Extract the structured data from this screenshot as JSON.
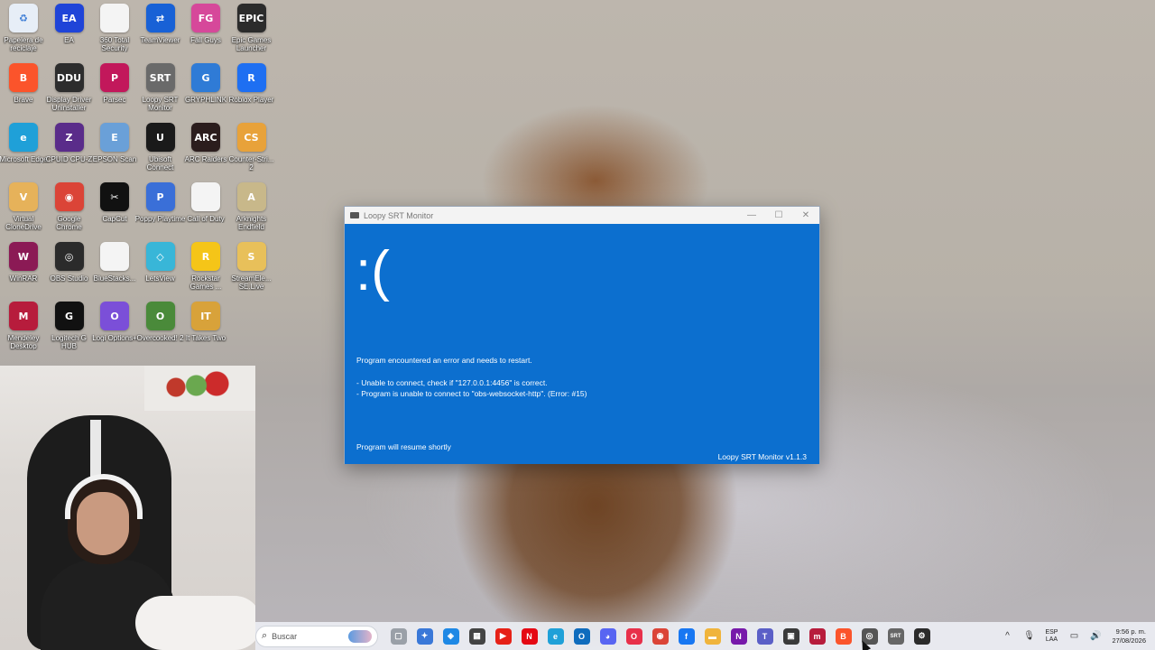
{
  "desktop": {
    "icons": [
      {
        "label": "Papelera de reciclaje",
        "color": "#e7eef7",
        "glyph": "♻"
      },
      {
        "label": "EA",
        "color": "#1f44d8",
        "glyph": "EA"
      },
      {
        "label": "360 Total Security",
        "color": "#f4f4f4",
        "glyph": ""
      },
      {
        "label": "TeamViewer",
        "color": "#1861d6",
        "glyph": "⇄"
      },
      {
        "label": "Fall Guys",
        "color": "#d6489a",
        "glyph": "FG"
      },
      {
        "label": "Epic Games Launcher",
        "color": "#2b2b2b",
        "glyph": "EPIC"
      },
      {
        "label": "Brave",
        "color": "#fb542b",
        "glyph": "B"
      },
      {
        "label": "Display Driver Uninstaller",
        "color": "#2d2d2d",
        "glyph": "DDU"
      },
      {
        "label": "Parsec",
        "color": "#c2185b",
        "glyph": "P"
      },
      {
        "label": "Loopy SRT Monitor",
        "color": "#6a6a6a",
        "glyph": "SRT"
      },
      {
        "label": "GRYPHLINK",
        "color": "#2f7bd6",
        "glyph": "G"
      },
      {
        "label": "Roblox Player",
        "color": "#1e6ff2",
        "glyph": "R"
      },
      {
        "label": "Microsoft Edge",
        "color": "#1fa0d8",
        "glyph": "e"
      },
      {
        "label": "CPUID CPU-Z",
        "color": "#5a2c8a",
        "glyph": "Z"
      },
      {
        "label": "EPSON Scan",
        "color": "#6aa0d8",
        "glyph": "E"
      },
      {
        "label": "Ubisoft Connect",
        "color": "#1a1a1a",
        "glyph": "U"
      },
      {
        "label": "ARC Raiders",
        "color": "#2b1d1d",
        "glyph": "ARC"
      },
      {
        "label": "Counter-Stri... 2",
        "color": "#e8a23a",
        "glyph": "CS"
      },
      {
        "label": "Virtual CloneDrive",
        "color": "#e6b25a",
        "glyph": "V"
      },
      {
        "label": "Google Chrome",
        "color": "#db4437",
        "glyph": "◉"
      },
      {
        "label": "CapCut",
        "color": "#111111",
        "glyph": "✂"
      },
      {
        "label": "Poppy Playtime",
        "color": "#3a6fd8",
        "glyph": "P"
      },
      {
        "label": "Call of Duty",
        "color": "#f4f4f4",
        "glyph": ""
      },
      {
        "label": "Arknights Endfield",
        "color": "#c8b88a",
        "glyph": "A"
      },
      {
        "label": "WinRAR",
        "color": "#8b1a55",
        "glyph": "W"
      },
      {
        "label": "OBS Studio",
        "color": "#2b2b2b",
        "glyph": "◎"
      },
      {
        "label": "BlueStacks...",
        "color": "#f4f4f4",
        "glyph": ""
      },
      {
        "label": "LetsView",
        "color": "#38b6d8",
        "glyph": "◇"
      },
      {
        "label": "Rockstar Games ...",
        "color": "#f5c518",
        "glyph": "R"
      },
      {
        "label": "StreamEle... SE.Live",
        "color": "#e8c05a",
        "glyph": "S"
      },
      {
        "label": "Mendeley Desktop",
        "color": "#b71c3c",
        "glyph": "M"
      },
      {
        "label": "Logitech G HUB",
        "color": "#111111",
        "glyph": "G"
      },
      {
        "label": "Logi Options+",
        "color": "#7b4fd8",
        "glyph": "O"
      },
      {
        "label": "Overcooked! 2",
        "color": "#4a8a3a",
        "glyph": "O"
      },
      {
        "label": "It Takes Two",
        "color": "#d8a23a",
        "glyph": "IT"
      }
    ]
  },
  "srt_window": {
    "title": "Loopy SRT Monitor",
    "minimize": "—",
    "maximize": "☐",
    "close": "✕",
    "face": ":(",
    "message": "Program encountered an error and needs to restart.",
    "detail_1": "- Unable to connect, check if \"127.0.0.1:4456\" is correct.",
    "detail_2": "- Program is unable to connect to \"obs-websocket-http\". (Error: #15)",
    "resume": "Program will resume shortly",
    "version": "Loopy SRT Monitor v1.1.3",
    "bg_color": "#0c6fcf"
  },
  "taskbar": {
    "search_placeholder": "Buscar",
    "icons": [
      {
        "name": "task-view",
        "color": "#9aa0a8",
        "glyph": "▢"
      },
      {
        "name": "copilot",
        "color": "#3a78d8",
        "glyph": "✦"
      },
      {
        "name": "app-blue",
        "color": "#1e88e5",
        "glyph": "◈"
      },
      {
        "name": "store",
        "color": "#444444",
        "glyph": "▦"
      },
      {
        "name": "youtube",
        "color": "#e62117",
        "glyph": "▶"
      },
      {
        "name": "netflix",
        "color": "#e50914",
        "glyph": "N"
      },
      {
        "name": "edge",
        "color": "#1fa0d8",
        "glyph": "e"
      },
      {
        "name": "outlook",
        "color": "#0f6cbd",
        "glyph": "O"
      },
      {
        "name": "discord",
        "color": "#5865f2",
        "glyph": "◕"
      },
      {
        "name": "opera",
        "color": "#e8304a",
        "glyph": "O"
      },
      {
        "name": "chrome",
        "color": "#db4437",
        "glyph": "◉"
      },
      {
        "name": "facebook",
        "color": "#1877f2",
        "glyph": "f"
      },
      {
        "name": "file-explorer",
        "color": "#f0b43c",
        "glyph": "▬"
      },
      {
        "name": "onenote",
        "color": "#7719aa",
        "glyph": "N"
      },
      {
        "name": "teams",
        "color": "#5b5fc7",
        "glyph": "T"
      },
      {
        "name": "obs-app",
        "color": "#3a3a3a",
        "glyph": "▣"
      },
      {
        "name": "mendeley",
        "color": "#b71c3c",
        "glyph": "m"
      },
      {
        "name": "brave",
        "color": "#fb542b",
        "glyph": "B"
      },
      {
        "name": "chrome-alt",
        "color": "#555555",
        "glyph": "◎"
      },
      {
        "name": "srt-monitor",
        "color": "#666666",
        "glyph": "SRT"
      },
      {
        "name": "settings",
        "color": "#2b2b2b",
        "glyph": "⚙"
      }
    ],
    "tray": {
      "chevron": "^",
      "mic": "🎙",
      "lang_1": "ESP",
      "lang_2": "LAA",
      "network": "▭",
      "volume": "🔊",
      "time": "9:56 p. m.",
      "date": "27/08/2026"
    }
  }
}
